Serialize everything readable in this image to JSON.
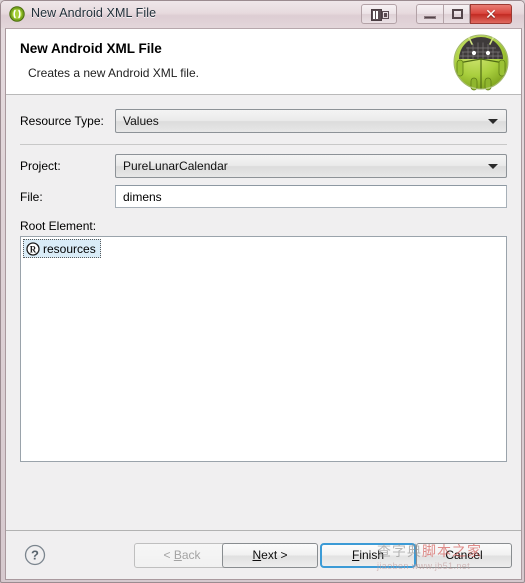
{
  "window": {
    "title": "New Android XML File",
    "icon": "android-wizard-icon",
    "titlebar_buttons": [
      {
        "name": "help-context-button",
        "label": ""
      },
      {
        "name": "minimize-button",
        "label": ""
      },
      {
        "name": "maximize-button",
        "label": ""
      },
      {
        "name": "close-button",
        "label": "✕"
      }
    ]
  },
  "header": {
    "title": "New Android XML File",
    "subtitle": "Creates a new Android XML file.",
    "badge_icon": "android-robot-icon"
  },
  "form": {
    "resource_type": {
      "label": "Resource Type:",
      "value": "Values",
      "placeholder": ""
    },
    "project": {
      "label": "Project:",
      "value": "PureLunarCalendar",
      "placeholder": ""
    },
    "file": {
      "label": "File:",
      "value": "dimens",
      "placeholder": ""
    },
    "root_element": {
      "label": "Root Element:",
      "items": [
        {
          "icon": "resource-r-icon",
          "label": "resources",
          "selected": true
        }
      ]
    }
  },
  "buttons": {
    "help": "?",
    "back": {
      "prefix": "< ",
      "mnemonic": "B",
      "suffix": "ack",
      "enabled": false
    },
    "next": {
      "prefix": "",
      "mnemonic": "N",
      "suffix": "ext >",
      "enabled": true
    },
    "finish": {
      "prefix": "",
      "mnemonic": "F",
      "suffix": "inish",
      "enabled": true,
      "default": true
    },
    "cancel": {
      "prefix": "",
      "mnemonic": "",
      "suffix": "Cancel",
      "enabled": true
    }
  },
  "watermark": {
    "line1_gray": "查字典",
    "line1_red": "脚本之家",
    "line2": "jiaoben  www.jb51.net"
  },
  "colors": {
    "accent": "#3c9bd6",
    "android_green": "#a4c639",
    "close_red": "#d9443c",
    "selection_blue": "#d9ecf7"
  }
}
